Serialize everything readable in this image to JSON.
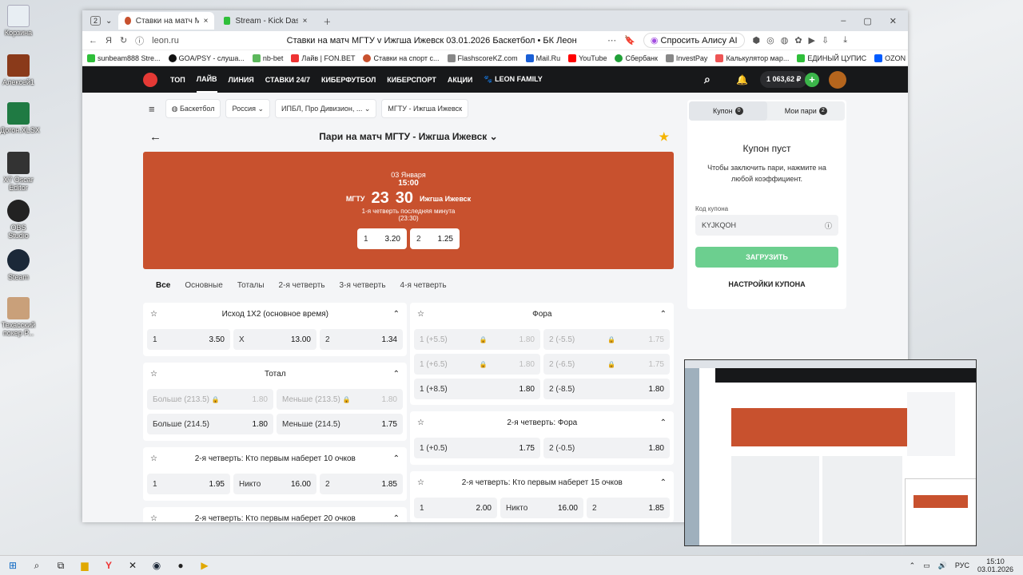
{
  "desktop": {
    "icons": [
      {
        "label": "Корзина"
      },
      {
        "label": "Алексей1"
      },
      {
        "label": "Догон.XLSX"
      },
      {
        "label": "X7 Oscar Editor"
      },
      {
        "label": "OBS Studio"
      },
      {
        "label": "Steam"
      },
      {
        "label": "Техасский покер Р..."
      }
    ]
  },
  "browser": {
    "tab_count": "2",
    "tabs": [
      {
        "label": "Ставки на матч МГТУ v"
      },
      {
        "label": "Stream - Kick Dashbo"
      }
    ],
    "address": "leon.ru",
    "page_title": "Ставки на матч МГТУ v Ижгша Ижевск 03.01.2026 Баскетбол • БК Леон",
    "alice": "Спросить Алису AI",
    "bookmarks": [
      "sunbeam888 Stre...",
      "GOA/PSY - слуша...",
      "nb-bet",
      "Лайв | FON.BET",
      "Ставки на спорт с...",
      "FlashscoreKZ.com",
      "Mail.Ru",
      "YouTube",
      "Сбербанк",
      "InvestPay",
      "Калькулятор мар...",
      "ЕДИНЫЙ ЦУПИС",
      "OZON м..."
    ]
  },
  "leon": {
    "nav": [
      "ТОП",
      "ЛАЙВ",
      "ЛИНИЯ",
      "СТАВКИ 24/7",
      "КИБЕРФУТБОЛ",
      "КИБЕРСПОРТ",
      "АКЦИИ",
      "LEON FAMILY"
    ],
    "balance": "1 063,62 ₽",
    "breadcrumbs": [
      "Баскетбол",
      "Россия",
      "ИПБЛ, Про Дивизион, ...",
      "МГТУ - Ижгша Ижевск"
    ],
    "match_title": "Пари на матч МГТУ - Ижгша Ижевск",
    "hero": {
      "date": "03 Января",
      "time": "15:00",
      "team1": "МГТУ",
      "score1": "23",
      "score2": "30",
      "team2": "Ижгша Ижевск",
      "status": "1-я четверть последняя минута",
      "clock": "(23:30)",
      "odd1_label": "1",
      "odd1_value": "3.20",
      "odd2_label": "2",
      "odd2_value": "1.25"
    },
    "subtabs": [
      "Все",
      "Основные",
      "Тоталы",
      "2-я четверть",
      "3-я четверть",
      "4-я четверть"
    ],
    "markets": {
      "m1": {
        "title": "Исход 1X2 (основное время)",
        "rows": [
          [
            [
              "1",
              "3.50"
            ],
            [
              "X",
              "13.00"
            ],
            [
              "2",
              "1.34"
            ]
          ]
        ]
      },
      "m2": {
        "title": "Тотал",
        "rows": [
          [
            [
              "Больше (213.5)",
              "1.80"
            ],
            [
              "Меньше (213.5)",
              "1.80"
            ]
          ],
          [
            [
              "Больше (214.5)",
              "1.80"
            ],
            [
              "Меньше (214.5)",
              "1.75"
            ]
          ]
        ]
      },
      "m3": {
        "title": "2-я четверть: Кто первым наберет 10 очков",
        "rows": [
          [
            [
              "1",
              "1.95"
            ],
            [
              "Никто",
              "16.00"
            ],
            [
              "2",
              "1.85"
            ]
          ]
        ]
      },
      "m4": {
        "title": "2-я четверть: Кто первым наберет 20 очков"
      },
      "f1": {
        "title": "Фора",
        "rows": [
          [
            [
              "1 (+5.5)",
              "1.80"
            ],
            [
              "2 (-5.5)",
              "1.75"
            ]
          ],
          [
            [
              "1 (+6.5)",
              "1.80"
            ],
            [
              "2 (-6.5)",
              "1.75"
            ]
          ],
          [
            [
              "1 (+8.5)",
              "1.80"
            ],
            [
              "2 (-8.5)",
              "1.80"
            ]
          ]
        ]
      },
      "f2": {
        "title": "2-я четверть: Фора",
        "rows": [
          [
            [
              "1 (+0.5)",
              "1.75"
            ],
            [
              "2 (-0.5)",
              "1.80"
            ]
          ]
        ]
      },
      "f3": {
        "title": "2-я четверть: Кто первым наберет 15 очков",
        "rows": [
          [
            [
              "1",
              "2.00"
            ],
            [
              "Никто",
              "16.00"
            ],
            [
              "2",
              "1.85"
            ]
          ]
        ]
      }
    },
    "coupon": {
      "tab1": "Купон",
      "tab1_count": "0",
      "tab2": "Мои пари",
      "tab2_count": "2",
      "empty_title": "Купон пуст",
      "empty_text": "Чтобы заключить пари, нажмите на любой коэффициент.",
      "code_label": "Код купона",
      "code_value": "KYJKQOH",
      "load_button": "ЗАГРУЗИТЬ",
      "settings": "НАСТРОЙКИ КУПОНА"
    }
  },
  "taskbar": {
    "lang": "РУС",
    "time": "15:10",
    "date": "03.01.2026"
  },
  "colors": {
    "brand": "#c8512e",
    "green": "#6ccf8f",
    "nav": "#17181a"
  }
}
